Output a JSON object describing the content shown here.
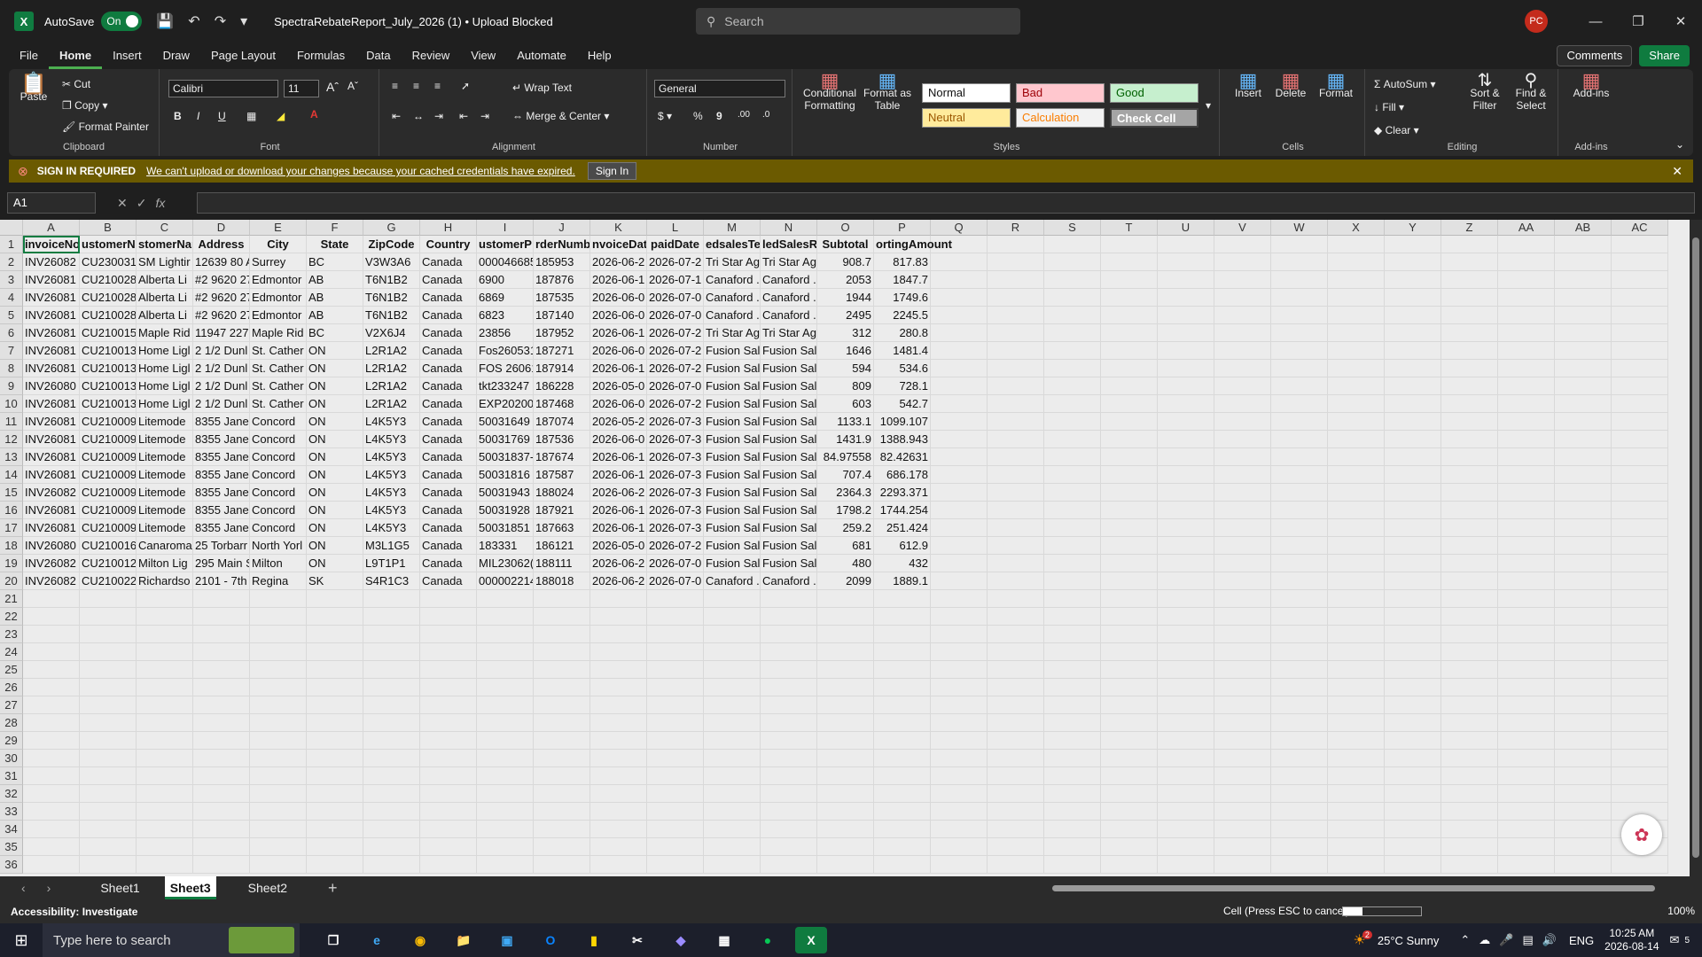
{
  "titlebar": {
    "autosave_label": "AutoSave",
    "toggle_label": "On",
    "file_title": "SpectraRebateReport_July_2026 (1) • Upload Blocked",
    "search_placeholder": "Search",
    "avatar_initials": "PC"
  },
  "menu": {
    "items": [
      "File",
      "Home",
      "Insert",
      "Draw",
      "Page Layout",
      "Formulas",
      "Data",
      "Review",
      "View",
      "Automate",
      "Help"
    ],
    "active": "Home",
    "comments": "Comments",
    "share": "Share"
  },
  "ribbon": {
    "clipboard": {
      "paste": "Paste",
      "cut": "Cut",
      "copy": "Copy",
      "format_painter": "Format Painter",
      "label": "Clipboard"
    },
    "font": {
      "family": "Calibri",
      "size": "11",
      "label": "Font"
    },
    "alignment": {
      "wrap": "Wrap Text",
      "merge": "Merge & Center",
      "label": "Alignment"
    },
    "number": {
      "format": "General",
      "label": "Number"
    },
    "styles": {
      "conditional": "Conditional Formatting",
      "format_table": "Format as Table",
      "normal": "Normal",
      "bad": "Bad",
      "good": "Good",
      "neutral": "Neutral",
      "calculation": "Calculation",
      "check_cell": "Check Cell",
      "label": "Styles"
    },
    "cells": {
      "insert": "Insert",
      "delete": "Delete",
      "format": "Format",
      "label": "Cells"
    },
    "editing": {
      "autosum": "AutoSum",
      "fill": "Fill",
      "clear": "Clear",
      "sort": "Sort & Filter",
      "find": "Find & Select",
      "label": "Editing"
    },
    "addins": {
      "addins": "Add-ins",
      "label": "Add-ins"
    }
  },
  "notice": {
    "title": "SIGN IN REQUIRED",
    "message": "We can't upload or download your changes because your cached credentials have expired.",
    "button": "Sign In"
  },
  "formula": {
    "namebox": "A1",
    "fx": "fx",
    "value": ""
  },
  "sheet": {
    "columns": [
      "A",
      "B",
      "C",
      "D",
      "E",
      "F",
      "G",
      "H",
      "I",
      "J",
      "K",
      "L",
      "M",
      "N",
      "O",
      "P",
      "Q",
      "R",
      "S",
      "T",
      "U",
      "V",
      "W",
      "X",
      "Y",
      "Z",
      "AA",
      "AB",
      "AC"
    ],
    "headers": [
      "invoiceNo",
      "ustomerN",
      "stomerNar",
      "Address",
      "City",
      "State",
      "ZipCode",
      "Country",
      "ustomerP",
      "rderNumb",
      "nvoiceDat",
      "paidDate",
      "edsalesTe",
      "ledSalesR",
      "Subtotal",
      "ortingAmount"
    ],
    "rows": [
      [
        "INV26082",
        "CU230031",
        "SM Lightir",
        "12639 80 A",
        "Surrey",
        "BC",
        "V3W3A6",
        "Canada",
        "000046685",
        "185953",
        "2026-06-2",
        "2026-07-2",
        "Tri Star Ag",
        "Tri Star Ag",
        "908.7",
        "817.83"
      ],
      [
        "INV26081",
        "CU210028",
        "Alberta Li",
        "#2 9620 27",
        "Edmontor",
        "AB",
        "T6N1B2",
        "Canada",
        "6900",
        "187876",
        "2026-06-1",
        "2026-07-1",
        "Canaford .",
        "Canaford .",
        "2053",
        "1847.7"
      ],
      [
        "INV26081",
        "CU210028",
        "Alberta Li",
        "#2 9620 27",
        "Edmontor",
        "AB",
        "T6N1B2",
        "Canada",
        "6869",
        "187535",
        "2026-06-0",
        "2026-07-0",
        "Canaford .",
        "Canaford .",
        "1944",
        "1749.6"
      ],
      [
        "INV26081",
        "CU210028",
        "Alberta Li",
        "#2 9620 27",
        "Edmontor",
        "AB",
        "T6N1B2",
        "Canada",
        "6823",
        "187140",
        "2026-06-0",
        "2026-07-0",
        "Canaford .",
        "Canaford .",
        "2495",
        "2245.5"
      ],
      [
        "INV26081",
        "CU210015",
        "Maple Rid",
        "11947 227",
        "Maple Rid",
        "BC",
        "V2X6J4",
        "Canada",
        "23856",
        "187952",
        "2026-06-1",
        "2026-07-2",
        "Tri Star Ag",
        "Tri Star Ag",
        "312",
        "280.8"
      ],
      [
        "INV26081",
        "CU210013",
        "Home Ligl",
        "2 1/2 Dunl",
        "St. Cather",
        "ON",
        "L2R1A2",
        "Canada",
        "Fos260531",
        "187271",
        "2026-06-0",
        "2026-07-2",
        "Fusion Sal",
        "Fusion Sal",
        "1646",
        "1481.4"
      ],
      [
        "INV26081",
        "CU210013",
        "Home Ligl",
        "2 1/2 Dunl",
        "St. Cather",
        "ON",
        "L2R1A2",
        "Canada",
        "FOS 26061",
        "187914",
        "2026-06-1",
        "2026-07-2",
        "Fusion Sal",
        "Fusion Sal",
        "594",
        "534.6"
      ],
      [
        "INV26080",
        "CU210013",
        "Home Ligl",
        "2 1/2 Dunl",
        "St. Cather",
        "ON",
        "L2R1A2",
        "Canada",
        "tkt233247",
        "186228",
        "2026-05-0",
        "2026-07-0",
        "Fusion Sal",
        "Fusion Sal",
        "809",
        "728.1"
      ],
      [
        "INV26081",
        "CU210013",
        "Home Ligl",
        "2 1/2 Dunl",
        "St. Cather",
        "ON",
        "L2R1A2",
        "Canada",
        "EXP20200",
        "187468",
        "2026-06-0",
        "2026-07-2",
        "Fusion Sal",
        "Fusion Sal",
        "603",
        "542.7"
      ],
      [
        "INV26081",
        "CU210009",
        "Litemode",
        "8355 Jane",
        "Concord",
        "ON",
        "L4K5Y3",
        "Canada",
        "50031649",
        "187074",
        "2026-05-2",
        "2026-07-3",
        "Fusion Sal",
        "Fusion Sal",
        "1133.1",
        "1099.107"
      ],
      [
        "INV26081",
        "CU210009",
        "Litemode",
        "8355 Jane",
        "Concord",
        "ON",
        "L4K5Y3",
        "Canada",
        "50031769",
        "187536",
        "2026-06-0",
        "2026-07-3",
        "Fusion Sal",
        "Fusion Sal",
        "1431.9",
        "1388.943"
      ],
      [
        "INV26081",
        "CU210009",
        "Litemode",
        "8355 Jane",
        "Concord",
        "ON",
        "L4K5Y3",
        "Canada",
        "50031837-",
        "187674",
        "2026-06-1",
        "2026-07-3",
        "Fusion Sal",
        "Fusion Sal",
        "84.97558",
        "82.42631"
      ],
      [
        "INV26081",
        "CU210009",
        "Litemode",
        "8355 Jane",
        "Concord",
        "ON",
        "L4K5Y3",
        "Canada",
        "50031816",
        "187587",
        "2026-06-1",
        "2026-07-3",
        "Fusion Sal",
        "Fusion Sal",
        "707.4",
        "686.178"
      ],
      [
        "INV26082",
        "CU210009",
        "Litemode",
        "8355 Jane",
        "Concord",
        "ON",
        "L4K5Y3",
        "Canada",
        "50031943",
        "188024",
        "2026-06-2",
        "2026-07-3",
        "Fusion Sal",
        "Fusion Sal",
        "2364.3",
        "2293.371"
      ],
      [
        "INV26081",
        "CU210009",
        "Litemode",
        "8355 Jane",
        "Concord",
        "ON",
        "L4K5Y3",
        "Canada",
        "50031928",
        "187921",
        "2026-06-1",
        "2026-07-3",
        "Fusion Sal",
        "Fusion Sal",
        "1798.2",
        "1744.254"
      ],
      [
        "INV26081",
        "CU210009",
        "Litemode",
        "8355 Jane",
        "Concord",
        "ON",
        "L4K5Y3",
        "Canada",
        "50031851",
        "187663",
        "2026-06-1",
        "2026-07-3",
        "Fusion Sal",
        "Fusion Sal",
        "259.2",
        "251.424"
      ],
      [
        "INV26080",
        "CU210016",
        "Canaroma",
        "25 Torbarr",
        "North Yorl",
        "ON",
        "M3L1G5",
        "Canada",
        "183331",
        "186121",
        "2026-05-0",
        "2026-07-2",
        "Fusion Sal",
        "Fusion Sal",
        "681",
        "612.9"
      ],
      [
        "INV26082",
        "CU210012",
        "Milton Lig",
        "295 Main S",
        "Milton",
        "ON",
        "L9T1P1",
        "Canada",
        "MIL23062(",
        "188111",
        "2026-06-2",
        "2026-07-0",
        "Fusion Sal",
        "Fusion Sal",
        "480",
        "432"
      ],
      [
        "INV26082",
        "CU210022",
        "Richardso",
        "2101 - 7th",
        "Regina",
        "SK",
        "S4R1C3",
        "Canada",
        "000002214",
        "188018",
        "2026-06-2",
        "2026-07-0",
        "Canaford .",
        "Canaford .",
        "2099",
        "1889.1"
      ]
    ],
    "row_count": 36
  },
  "tabs": {
    "sheets": [
      "Sheet1",
      "Sheet3",
      "Sheet2"
    ],
    "active": "Sheet3"
  },
  "status": {
    "accessibility": "Accessibility: Investigate",
    "cell_mode": "Cell (Press ESC to cancel):",
    "progress": 0.25,
    "zoom": "100%"
  },
  "taskbar": {
    "search": "Type here to search",
    "weather": "25°C  Sunny",
    "lang": "ENG",
    "time": "10:25 AM",
    "date": "2026-08-14",
    "notif_count": "5",
    "weather_badge": "2"
  }
}
